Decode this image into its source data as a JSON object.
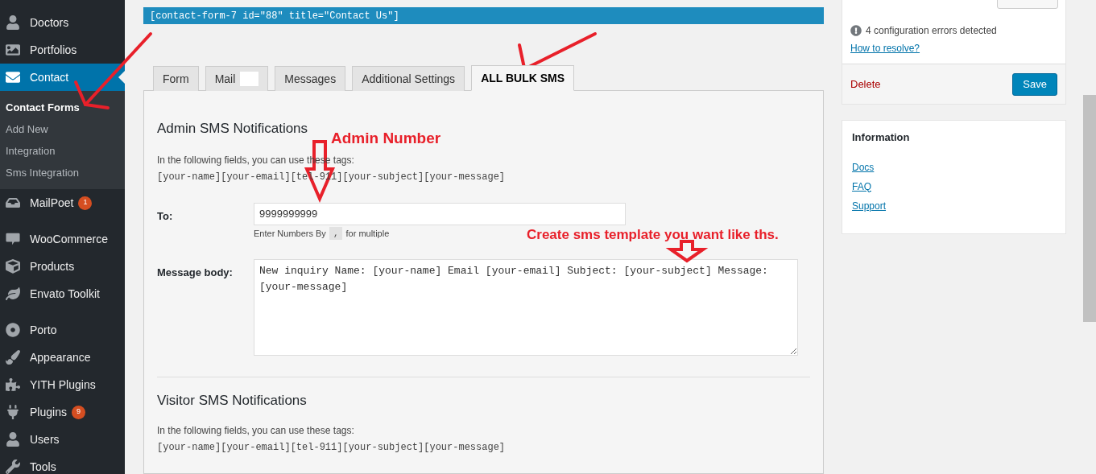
{
  "sidebar": {
    "groups": [
      [
        {
          "label": "Doctors",
          "current": false
        },
        {
          "label": "Portfolios",
          "current": false
        },
        {
          "label": "Contact",
          "current": true,
          "children": [
            {
              "label": "Contact Forms",
              "selected": true
            },
            {
              "label": "Add New",
              "selected": false
            },
            {
              "label": "Integration",
              "selected": false
            },
            {
              "label": "Sms Integration",
              "selected": false
            }
          ]
        },
        {
          "label": "MailPoet",
          "current": false,
          "badge": "1"
        }
      ],
      [
        {
          "label": "WooCommerce",
          "current": false
        },
        {
          "label": "Products",
          "current": false
        },
        {
          "label": "Envato Toolkit",
          "current": false
        }
      ],
      [
        {
          "label": "Porto",
          "current": false
        },
        {
          "label": "Appearance",
          "current": false
        },
        {
          "label": "YITH Plugins",
          "current": false
        },
        {
          "label": "Plugins",
          "current": false,
          "badge": "9"
        },
        {
          "label": "Users",
          "current": false
        },
        {
          "label": "Tools",
          "current": false
        }
      ]
    ]
  },
  "shortcode": {
    "code": "[contact-form-7 id=\"88\" title=\"Contact Us\"]"
  },
  "tabs": [
    {
      "label": "Form",
      "selected": false
    },
    {
      "label": "Mail",
      "selected": false
    },
    {
      "label": "Messages",
      "selected": false
    },
    {
      "label": "Additional Settings",
      "selected": false
    },
    {
      "label": "ALL BULK SMS",
      "selected": true
    }
  ],
  "admin": {
    "heading": "Admin SMS Notifications",
    "intro": "In the following fields, you can use these tags:",
    "tags": "[your-name][your-email][tel-911][your-subject][your-message]",
    "to": {
      "label": "To:",
      "value": "9999999999",
      "hint_before": "Enter Numbers By",
      "separator": ",",
      "hint_after": "for multiple"
    },
    "message": {
      "label": "Message body:",
      "value": "New inquiry Name: [your-name] Email [your-email] Subject: [your-subject] Message: [your-message]"
    }
  },
  "visitor": {
    "heading": "Visitor SMS Notifications",
    "intro": "In the following fields, you can use these tags:",
    "tags": "[your-name][your-email][tel-911][your-subject][your-message]"
  },
  "status_box": {
    "errors": "4 configuration errors detected",
    "resolve_link": "How to resolve?",
    "delete": "Delete",
    "save": "Save"
  },
  "info_box": {
    "title": "Information",
    "links": [
      "Docs",
      "FAQ",
      "Support"
    ]
  },
  "annotations": [
    "Admin Number",
    "Create sms template you want like ths."
  ]
}
